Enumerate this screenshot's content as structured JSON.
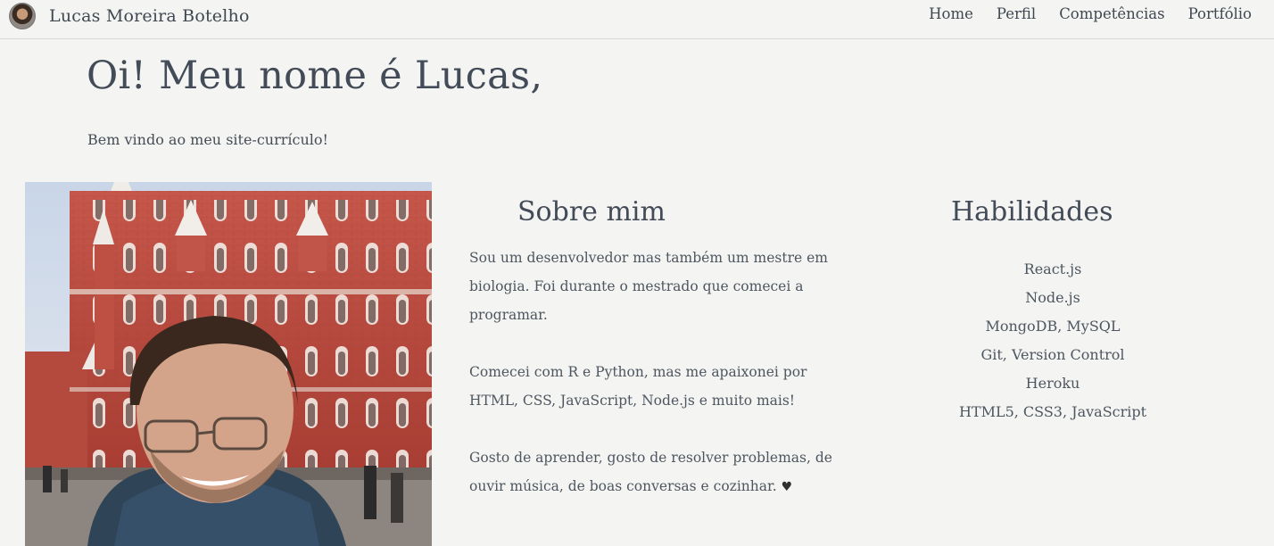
{
  "navbar": {
    "brand": "Lucas Moreira Botelho",
    "links": [
      "Home",
      "Perfil",
      "Competências",
      "Portfólio"
    ]
  },
  "hero": {
    "title": "Oi! Meu nome é Lucas,",
    "subtitle": "Bem vindo ao meu site-currículo!"
  },
  "about": {
    "title": "Sobre mim",
    "paragraphs": [
      "Sou um desenvolvedor mas também um mestre em biologia. Foi durante o mestrado que comecei a programar.",
      "Comecei com R e Python, mas me apaixonei por HTML, CSS, JavaScript, Node.js e muito mais!",
      "Gosto de aprender, gosto de resolver problemas, de ouvir música, de boas conversas e cozinhar."
    ],
    "heart": "♥"
  },
  "skills": {
    "title": "Habilidades",
    "items": [
      "React.js",
      "Node.js",
      "MongoDB, MySQL",
      "Git, Version Control",
      "Heroku",
      "HTML5, CSS3, JavaScript"
    ]
  },
  "icons": {
    "avatar": "avatar-icon",
    "heart": "heart-icon"
  },
  "colors": {
    "background": "#f4f4f2",
    "text": "#414a54",
    "building": "#b9463a"
  }
}
